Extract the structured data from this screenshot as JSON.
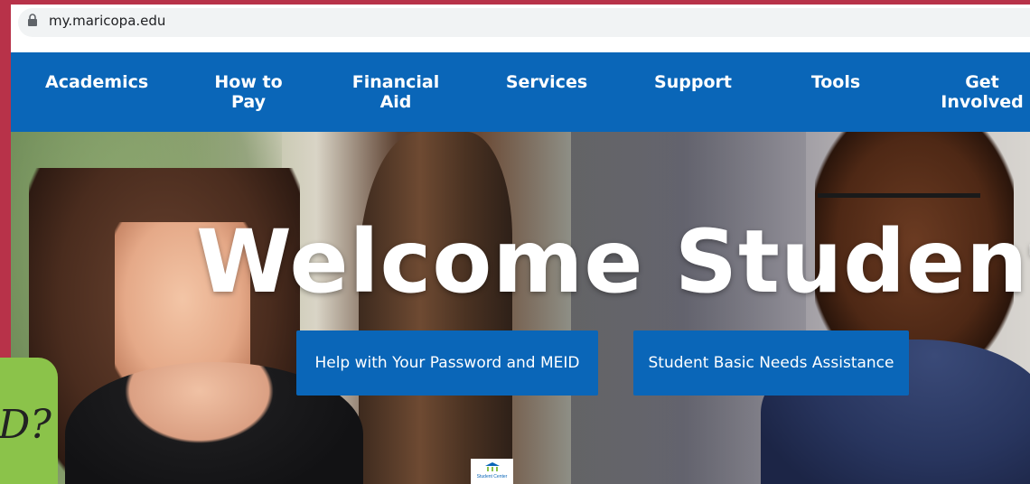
{
  "browser": {
    "url": "my.maricopa.edu"
  },
  "nav": {
    "items": [
      {
        "label": "Academics"
      },
      {
        "label": "How to\nPay"
      },
      {
        "label": "Financial\nAid"
      },
      {
        "label": "Services"
      },
      {
        "label": "Support"
      },
      {
        "label": "Tools"
      },
      {
        "label": "Get\nInvolved"
      }
    ]
  },
  "hero": {
    "title": "Welcome Students",
    "buttons": [
      {
        "label": "Help with Your Password and MEID"
      },
      {
        "label": "Student Basic Needs Assistance"
      }
    ],
    "student_center_label": "Student Center"
  },
  "overlay": {
    "text": "D?"
  },
  "colors": {
    "nav_bg": "#0a66b8",
    "frame": "#b83249",
    "overlay_green": "#8bc34a"
  }
}
